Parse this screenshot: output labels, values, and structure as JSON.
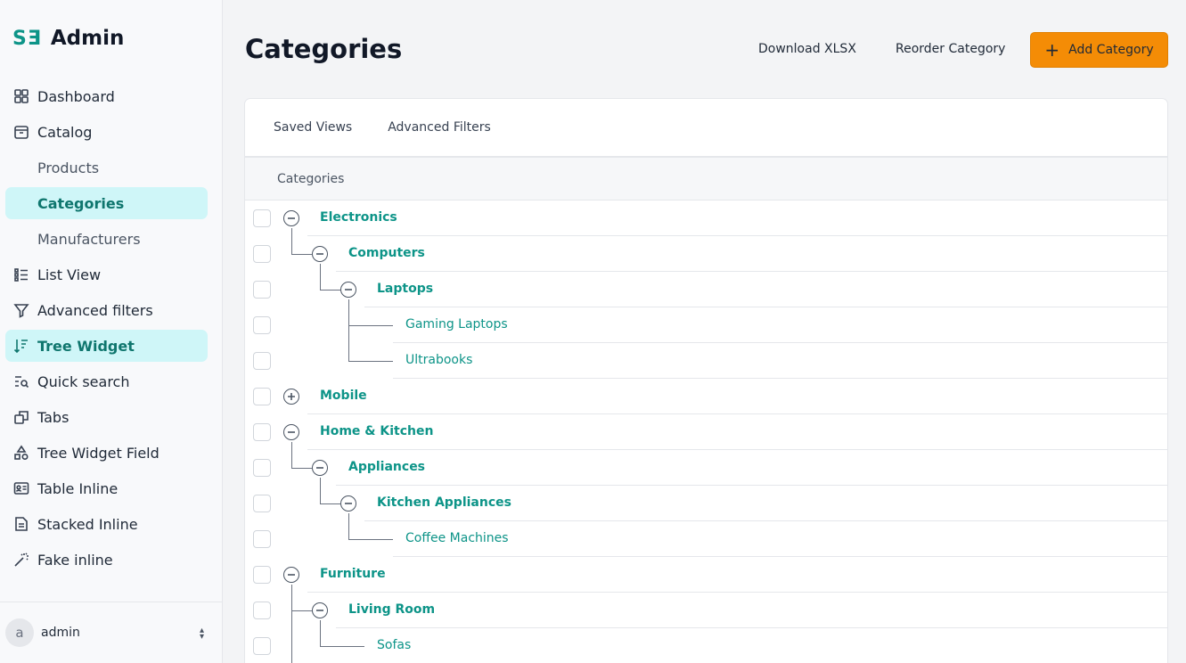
{
  "app": {
    "logo_mark": "SƎ",
    "name": "Admin"
  },
  "sidebar": {
    "items": [
      {
        "label": "Dashboard",
        "icon": "grid-icon"
      },
      {
        "label": "Catalog",
        "icon": "box-icon"
      },
      {
        "label": "Products",
        "sub": true
      },
      {
        "label": "Categories",
        "sub": true,
        "active": true
      },
      {
        "label": "Manufacturers",
        "sub": true
      },
      {
        "label": "List View",
        "icon": "list-icon"
      },
      {
        "label": "Advanced filters",
        "icon": "filter-icon"
      },
      {
        "label": "Tree Widget",
        "icon": "sort-icon",
        "active": true
      },
      {
        "label": "Quick search",
        "icon": "search-list-icon"
      },
      {
        "label": "Tabs",
        "icon": "tabs-icon"
      },
      {
        "label": "Tree Widget Field",
        "icon": "shapes-icon"
      },
      {
        "label": "Table Inline",
        "icon": "id-card-icon"
      },
      {
        "label": "Stacked Inline",
        "icon": "document-icon"
      },
      {
        "label": "Fake inline",
        "icon": "magic-wand-icon"
      }
    ],
    "user": {
      "avatar_letter": "a",
      "name": "admin"
    }
  },
  "header": {
    "title": "Categories",
    "download_label": "Download XLSX",
    "reorder_label": "Reorder Category",
    "add_label": "Add Category"
  },
  "panel": {
    "tabs": [
      "Saved Views",
      "Advanced Filters"
    ],
    "column_header": "Categories",
    "rows": [
      {
        "label": "Electronics",
        "level": 0,
        "toggle": "minus"
      },
      {
        "label": "Computers",
        "level": 1,
        "toggle": "minus"
      },
      {
        "label": "Laptops",
        "level": 2,
        "toggle": "minus"
      },
      {
        "label": "Gaming Laptops",
        "level": 3,
        "toggle": "none"
      },
      {
        "label": "Ultrabooks",
        "level": 3,
        "toggle": "none"
      },
      {
        "label": "Mobile",
        "level": 0,
        "toggle": "plus"
      },
      {
        "label": "Home & Kitchen",
        "level": 0,
        "toggle": "minus"
      },
      {
        "label": "Appliances",
        "level": 1,
        "toggle": "minus"
      },
      {
        "label": "Kitchen Appliances",
        "level": 2,
        "toggle": "minus"
      },
      {
        "label": "Coffee Machines",
        "level": 3,
        "toggle": "none"
      },
      {
        "label": "Furniture",
        "level": 0,
        "toggle": "minus"
      },
      {
        "label": "Living Room",
        "level": 1,
        "toggle": "minus"
      },
      {
        "label": "Sofas",
        "level": 2,
        "toggle": "none"
      }
    ]
  },
  "colors": {
    "accent": "#0d9488",
    "active_bg": "#cff6f8",
    "button": "#f48c06"
  }
}
